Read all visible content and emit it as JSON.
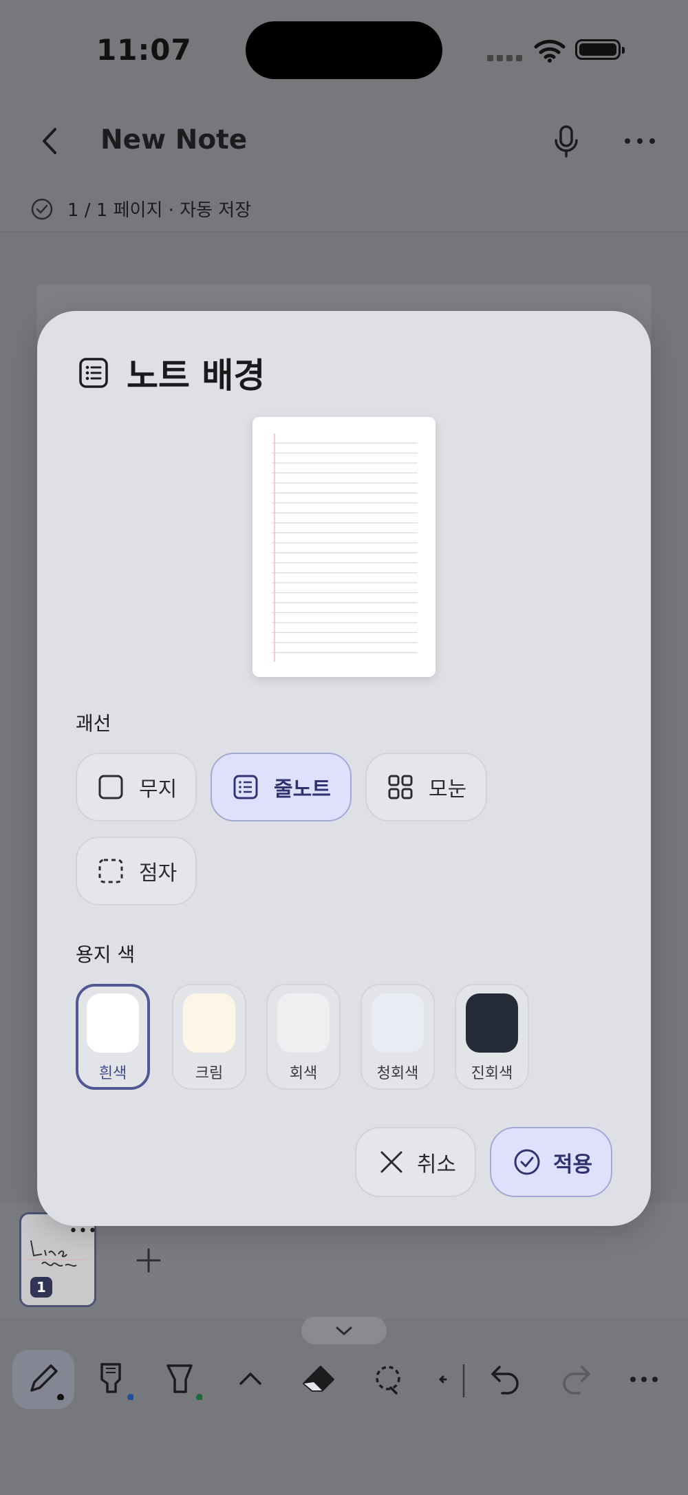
{
  "status_bar": {
    "time": "11:07"
  },
  "header": {
    "title": "New Note",
    "subtitle": "1 / 1 페이지 · 자동 저장"
  },
  "modal": {
    "title": "노트 배경",
    "ruling_label": "괘선",
    "ruling_options": [
      {
        "label": "무지",
        "icon": "blank-square-icon",
        "selected": false
      },
      {
        "label": "줄노트",
        "icon": "lined-list-icon",
        "selected": true
      },
      {
        "label": "모눈",
        "icon": "grid-icon",
        "selected": false
      },
      {
        "label": "점자",
        "icon": "dotted-square-icon",
        "selected": false
      }
    ],
    "paper_color_label": "용지 색",
    "paper_colors": [
      {
        "label": "흰색",
        "color": "#ffffff",
        "selected": true
      },
      {
        "label": "크림",
        "color": "#fdf6e6",
        "selected": false
      },
      {
        "label": "회색",
        "color": "#eeeff1",
        "selected": false
      },
      {
        "label": "청회색",
        "color": "#e9ecf2",
        "selected": false
      },
      {
        "label": "진회색",
        "color": "#262b38",
        "selected": false
      }
    ],
    "cancel_label": "취소",
    "apply_label": "적용"
  },
  "pages": {
    "thumbnail_badge": "1",
    "thumbnail_text": "Lina Notes"
  },
  "colors": {
    "accent": "#4f5894",
    "selected_bg": "#dfe0fb",
    "pen_dot": "#111111",
    "marker_dot": "#1f4e9c",
    "highlighter_dot": "#1c6b3a"
  }
}
